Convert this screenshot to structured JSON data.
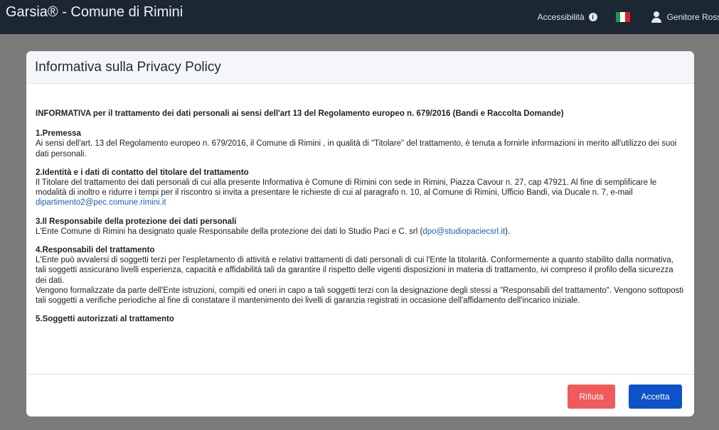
{
  "navbar": {
    "brand": "Garsia® - Comune di Rimini",
    "accessibility_label": "Accessibilità",
    "accessibility_icon": "info-icon",
    "language_icon": "italian-flag-icon",
    "user_icon": "user-icon",
    "user_name": "Genitore Rossi"
  },
  "modal": {
    "title": "Informativa sulla Privacy Policy",
    "intro": "INFORMATIVA per il trattamento dei dati personali ai sensi dell'art 13 del Regolamento europeo n. 679/2016 (Bandi e Raccolta Domande)",
    "sections": [
      {
        "title": "1.Premessa",
        "text": "Ai sensi dell'art. 13 del Regolamento europeo n. 679/2016, il Comune di Rimini , in qualità di \"Titolare\" del trattamento, è tenuta a fornirle informazioni in merito all'utilizzo dei suoi dati personali."
      },
      {
        "title": "2.Identità e i dati di contatto del titolare del trattamento",
        "text": "Il Titolare del trattamento dei dati personali di cui alla presente Informativa è Comune di Rimini con sede in Rimini, Piazza Cavour n. 27, cap 47921. Al fine di semplificare le modalità di inoltro e ridurre i tempi per il riscontro si invita a presentare le richieste di cui al paragrafo n. 10, al Comune di Rimini, Ufficio Bandi, via Ducale n. 7, e-mail",
        "link": "dipartimento2@pec.comune.rimini.it"
      },
      {
        "title": "3.Il Responsabile della protezione dei dati personali",
        "text_before": "L'Ente Comune di Rimini ha designato quale Responsabile della protezione dei dati lo Studio Paci e C. srl (",
        "link": "dpo@studiopaciecsrl.it",
        "text_after": ")."
      },
      {
        "title": "4.Responsabili del trattamento",
        "text": "L'Ente può avvalersi di soggetti terzi per l'espletamento di attività e relativi trattamenti di dati personali di cui l'Ente la titolarità. Conformemente a quanto stabilito dalla normativa, tali soggetti assicurano livelli esperienza, capacità e affidabilità tali da garantire il rispetto delle vigenti disposizioni in materia di trattamento, ivi compreso il profilo della sicurezza dei dati.",
        "text2": "Vengono formalizzate da parte dell'Ente istruzioni, compiti ed oneri in capo a tali soggetti terzi con la designazione degli stessi a \"Responsabili del trattamento\". Vengono sottoposti tali soggetti a verifiche periodiche al fine di constatare il mantenimento dei livelli di garanzia registrati in occasione dell'affidamento dell'incarico iniziale."
      },
      {
        "title": "5.Soggetti autorizzati al trattamento"
      }
    ],
    "buttons": {
      "reject": "Rifiuta",
      "accept": "Accetta"
    }
  },
  "colors": {
    "navbar": "#1b2733",
    "reject": "#ef5b5b",
    "accept": "#0d52c8",
    "link": "#1a5fb4"
  }
}
